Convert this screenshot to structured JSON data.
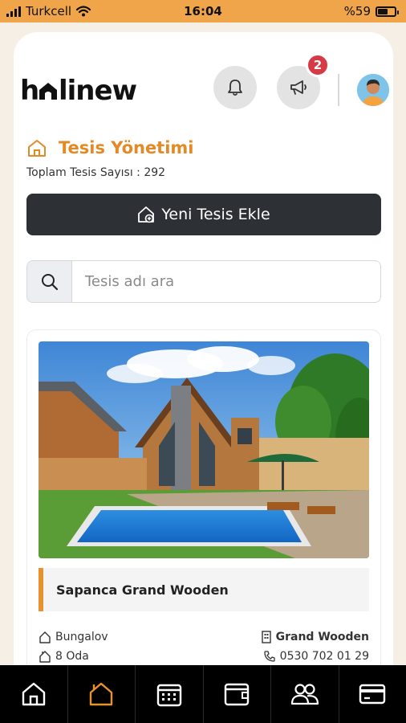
{
  "status_bar": {
    "carrier": "Turkcell",
    "time": "16:04",
    "battery_text": "%59",
    "battery_level": 0.59
  },
  "header": {
    "logo_text": "holinew",
    "notification_icon": "bell-icon",
    "announcement_icon": "megaphone-icon",
    "announcement_badge": "2",
    "avatar": "user-avatar"
  },
  "page": {
    "title": "Tesis Yönetimi",
    "title_icon": "home-outline-icon",
    "total_label": "Toplam Tesis Sayısı : 292",
    "add_button_label": "Yeni Tesis Ekle",
    "add_button_icon": "home-add-icon"
  },
  "search": {
    "placeholder": "Tesis adı ara",
    "icon": "search-icon"
  },
  "facilities": [
    {
      "name": "Sapanca Grand Wooden",
      "type": "Bungalov",
      "rooms": "8 Oda",
      "owner": "Grand Wooden",
      "phone": "0530 702 01 29"
    }
  ],
  "bottom_nav": [
    {
      "icon": "home-icon",
      "active": false
    },
    {
      "icon": "facility-home-icon",
      "active": true
    },
    {
      "icon": "calendar-icon",
      "active": false
    },
    {
      "icon": "wallet-icon",
      "active": false
    },
    {
      "icon": "users-icon",
      "active": false
    },
    {
      "icon": "credit-card-icon",
      "active": false
    }
  ],
  "colors": {
    "status_bar": "#f1a54a",
    "accent": "#e38a26",
    "dark_button": "#2d3035",
    "badge": "#d63a44",
    "nav_bg": "#000000",
    "nav_active": "#e8922d"
  }
}
